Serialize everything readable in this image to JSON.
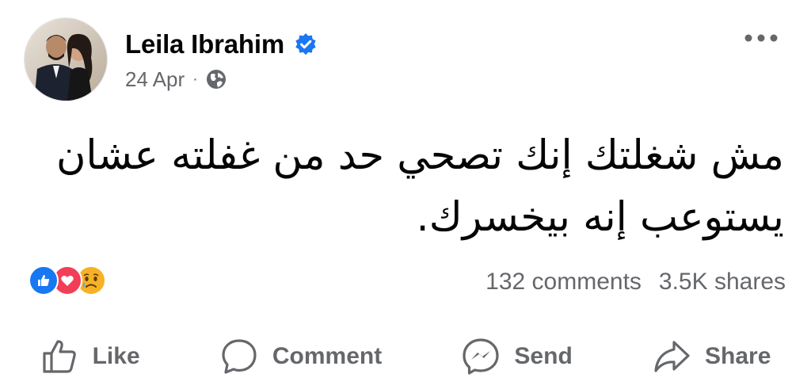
{
  "post": {
    "author": "Leila Ibrahim",
    "verified_icon": "verified-badge-icon",
    "date": "24 Apr",
    "separator": "·",
    "audience_icon": "globe-icon",
    "more_icon": "more-options-icon",
    "text": "مش شغلتك إنك تصحي حد من غفلته عشان يستوعب إنه بيخسرك."
  },
  "reactions": {
    "icons": [
      "like-reaction-icon",
      "love-reaction-icon",
      "sad-reaction-icon"
    ],
    "comments": "132 comments",
    "shares": "3.5K shares"
  },
  "actions": {
    "like": "Like",
    "comment": "Comment",
    "send": "Send",
    "share": "Share"
  },
  "colors": {
    "accent": "#1877f2",
    "secondary_text": "#65676b",
    "love": "#f33e58",
    "sad": "#f7b125"
  }
}
